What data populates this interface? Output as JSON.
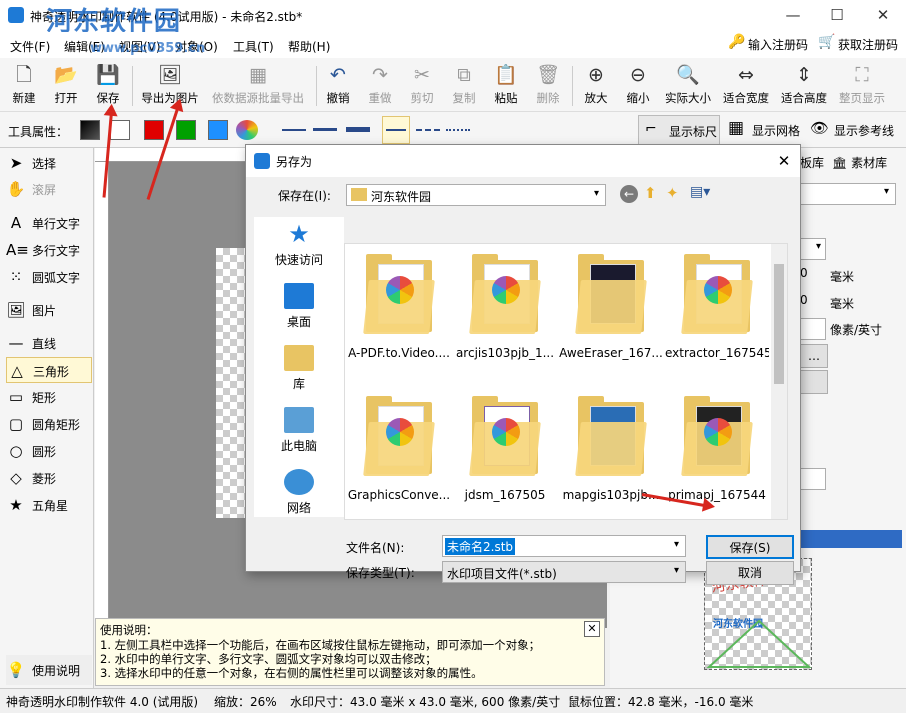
{
  "window": {
    "title": "神奇透明水印制作软件 (4.0试用版) - 未命名2.stb*",
    "watermark_site": "河东软件园",
    "watermark_url": "www.pc0359.cn"
  },
  "menu": [
    "文件(F)",
    "编辑(E)",
    "视图(V)",
    "对象(O)",
    "工具(T)",
    "帮助(H)"
  ],
  "register": {
    "enter": "输入注册码",
    "get": "获取注册码"
  },
  "toolbar": {
    "new": "新建",
    "open": "打开",
    "save": "保存",
    "export_img": "导出为图片",
    "batch_export": "依数据源批量导出",
    "undo": "撤销",
    "redo": "重做",
    "cut": "剪切",
    "copy": "复制",
    "paste": "粘贴",
    "delete": "删除",
    "zoom_in": "放大",
    "zoom_out": "缩小",
    "actual": "实际大小",
    "fit_width": "适合宽度",
    "fit_height": "适合高度",
    "full_page": "整页显示"
  },
  "propbar": {
    "label": "工具属性：",
    "show_ruler": "显示标尺",
    "show_grid": "显示网格",
    "show_guides": "显示参考线"
  },
  "tools": [
    "选择",
    "滚屏",
    "单行文字",
    "多行文字",
    "圆弧文字",
    "图片",
    "直线",
    "三角形",
    "矩形",
    "圆角矩形",
    "圆形",
    "菱形",
    "五角星"
  ],
  "tools_footer": "使用说明",
  "right": {
    "tab1": "板库",
    "tab2": "素材库",
    "unit1": "毫米",
    "unit2": "毫米",
    "unit3": "像素/英寸",
    "preview_text": "河东软件",
    "preview_site": "河东软件园"
  },
  "help": {
    "title": "使用说明：",
    "lines": [
      "1. 左侧工具栏中选择一个功能后，在画布区域按住鼠标左键拖动，即可添加一个对象；",
      "2. 水印中的单行文字、多行文字、圆弧文字对象均可以双击修改；",
      "3. 选择水印中的任意一个对象，在右侧的属性栏里可以调整该对象的属性。"
    ]
  },
  "status": {
    "app": "神奇透明水印制作软件 4.0 (试用版)",
    "zoom": "缩放：26%",
    "size": "水印尺寸：43.0 毫米 x 43.0 毫米, 600 像素/英寸",
    "pos": "鼠标位置：42.8 毫米，-16.0 毫米"
  },
  "dialog": {
    "title": "另存为",
    "save_in_label": "保存在(I):",
    "save_in_value": "河东软件园",
    "places": [
      "快速访问",
      "桌面",
      "库",
      "此电脑",
      "网络"
    ],
    "files": [
      "A-PDF.to.Video....",
      "arcjis103pjb_1...",
      "AweEraser_167...",
      "extractor_167545",
      "GraphicsConve...",
      "jdsm_167505",
      "mapgis103pjb...",
      "primapj_167544"
    ],
    "filename_label": "文件名(N):",
    "filename_value": "未命名2.stb",
    "filetype_label": "保存类型(T):",
    "filetype_value": "水印项目文件(*.stb)",
    "save_button": "保存(S)",
    "cancel_button": "取消"
  }
}
